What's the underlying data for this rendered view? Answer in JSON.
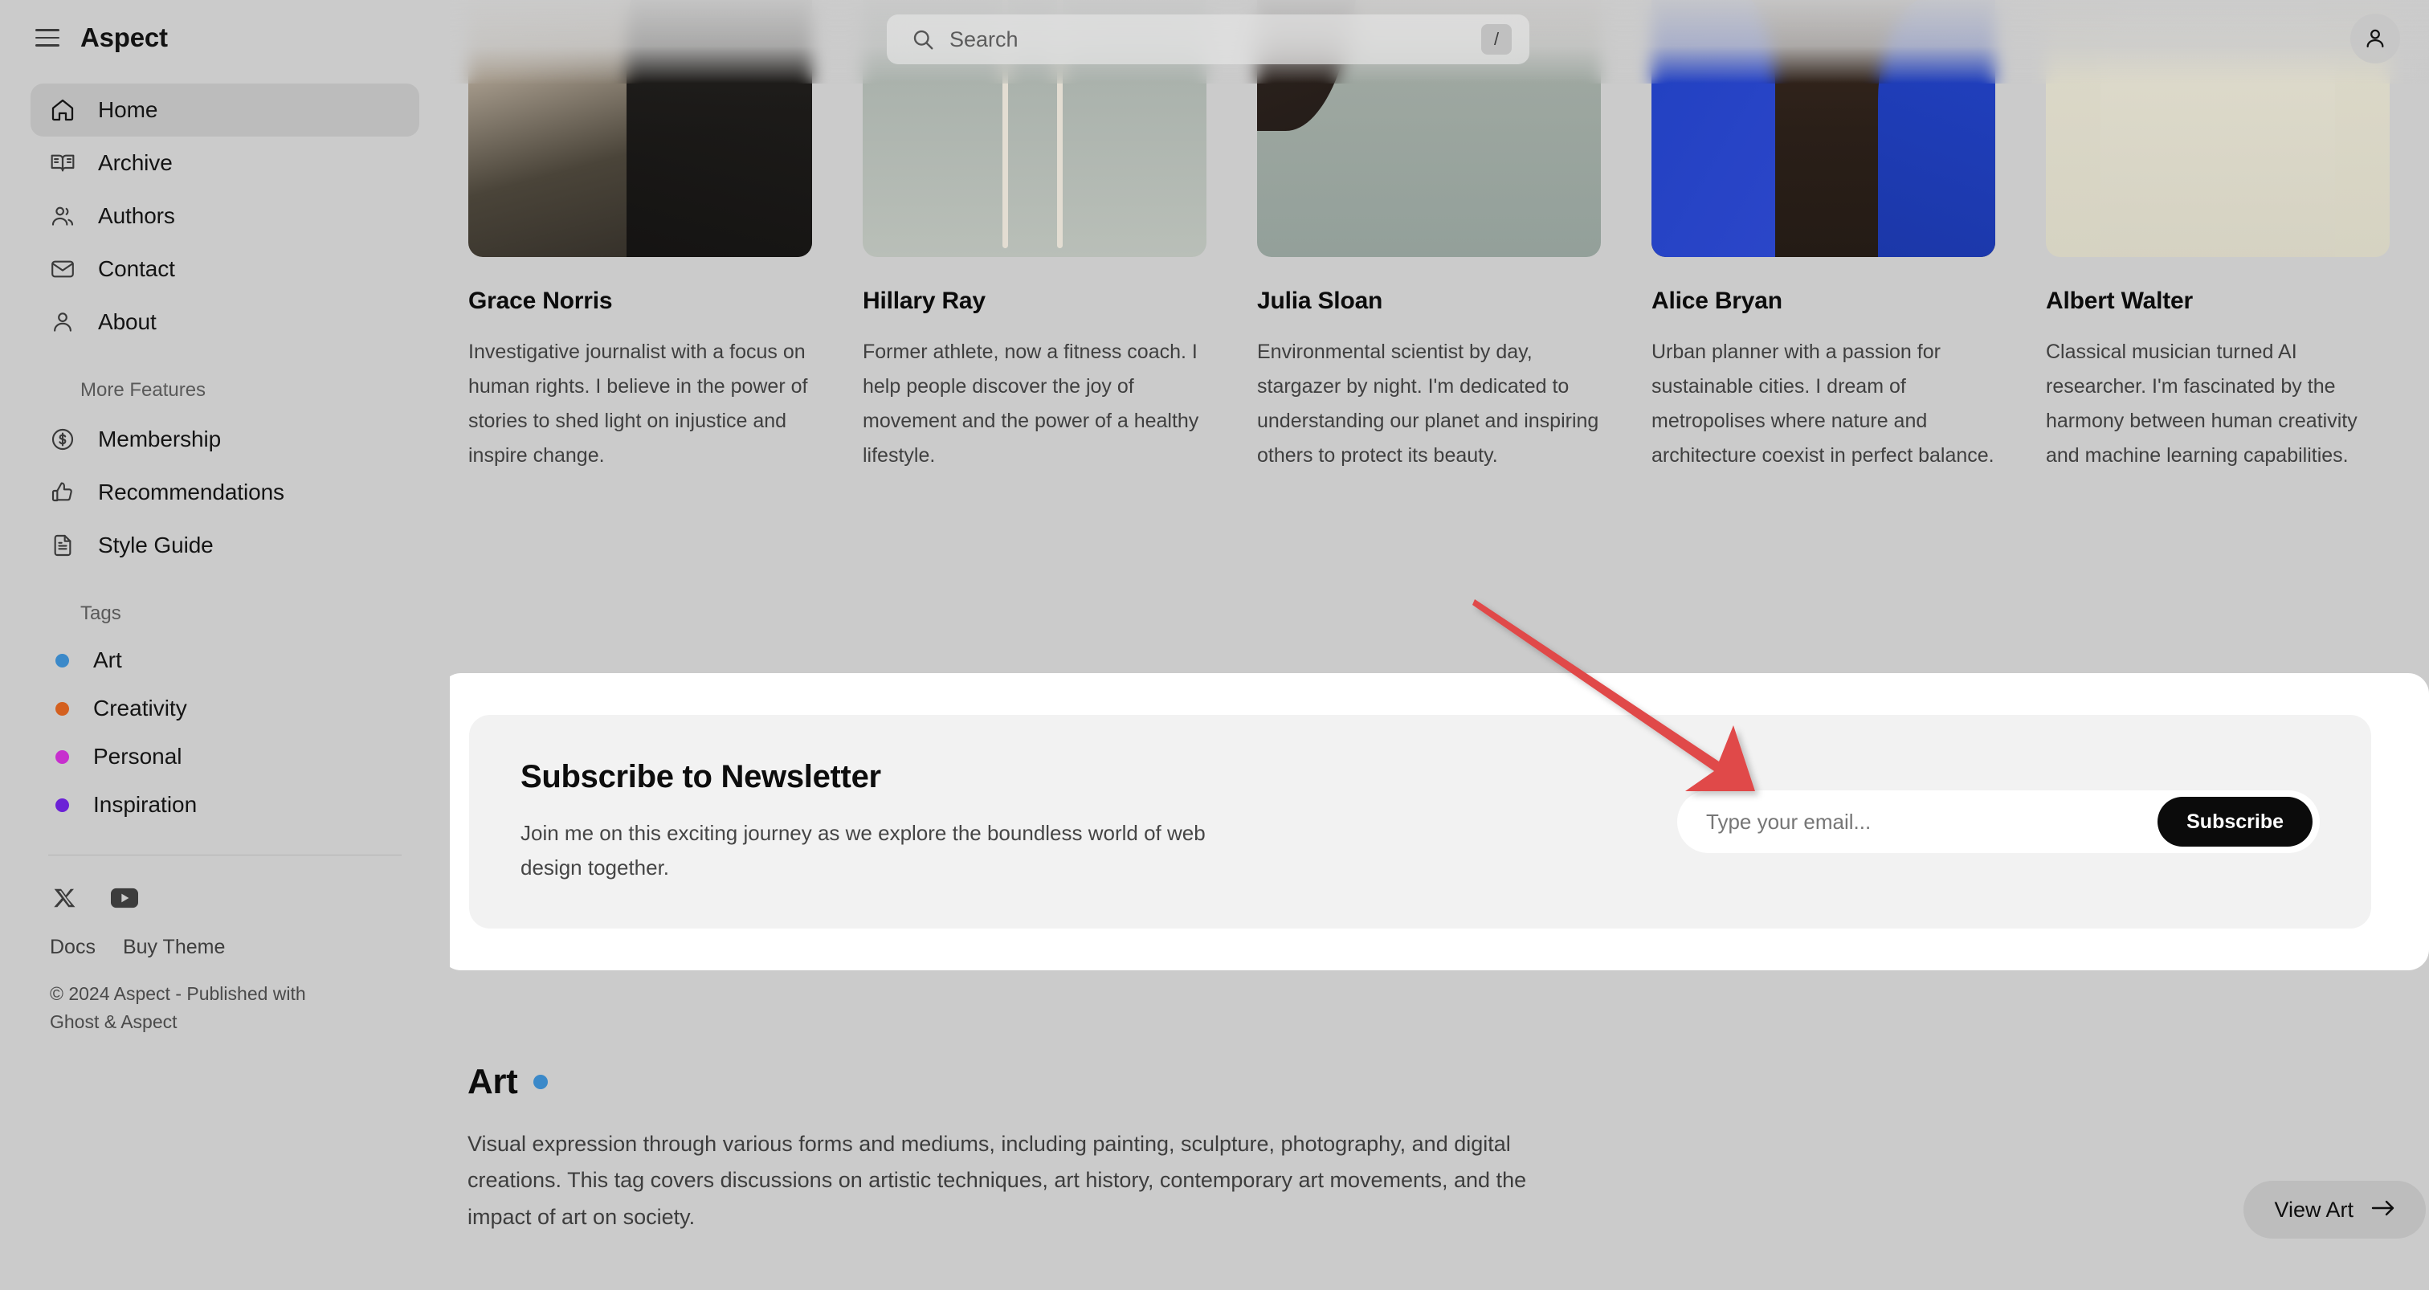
{
  "brand": {
    "name": "Aspect",
    "menu_icon": "hamburger-icon"
  },
  "search": {
    "placeholder": "Search",
    "shortcut": "/",
    "icon": "search-icon"
  },
  "header": {
    "account_icon": "user-avatar-icon"
  },
  "sidebar": {
    "nav": [
      {
        "label": "Home",
        "icon": "home-icon",
        "active": true
      },
      {
        "label": "Archive",
        "icon": "book-open-icon",
        "active": false
      },
      {
        "label": "Authors",
        "icon": "users-icon",
        "active": false
      },
      {
        "label": "Contact",
        "icon": "envelope-icon",
        "active": false
      },
      {
        "label": "About",
        "icon": "person-icon",
        "active": false
      }
    ],
    "more_features_label": "More Features",
    "features": [
      {
        "label": "Membership",
        "icon": "dollar-circle-icon"
      },
      {
        "label": "Recommendations",
        "icon": "thumbs-up-icon"
      },
      {
        "label": "Style Guide",
        "icon": "document-icon"
      }
    ],
    "tags_label": "Tags",
    "tags": [
      {
        "label": "Art",
        "color": "#3b89c9"
      },
      {
        "label": "Creativity",
        "color": "#d4601f"
      },
      {
        "label": "Personal",
        "color": "#c72fce"
      },
      {
        "label": "Inspiration",
        "color": "#6b21d6"
      }
    ],
    "socials": [
      {
        "name": "x-twitter-icon"
      },
      {
        "name": "youtube-icon"
      }
    ],
    "footer_links": [
      "Docs",
      "Buy Theme"
    ],
    "copyright": "© 2024 Aspect - Published with Ghost & Aspect"
  },
  "authors": [
    {
      "name": "Grace Norris",
      "bio": "Investigative journalist with a focus on human rights. I believe in the power of stories to shed light on injustice and inspire change.",
      "photo": "img1"
    },
    {
      "name": "Hillary Ray",
      "bio": "Former athlete, now a fitness coach. I help people discover the joy of movement and the power of a healthy lifestyle.",
      "photo": "img2"
    },
    {
      "name": "Julia Sloan",
      "bio": "Environmental scientist by day, stargazer by night. I'm dedicated to understanding our planet and inspiring others to protect its beauty.",
      "photo": "img3"
    },
    {
      "name": "Alice Bryan",
      "bio": "Urban planner with a passion for sustainable cities. I dream of metropolises where nature and architecture coexist in perfect balance.",
      "photo": "img4"
    },
    {
      "name": "Albert Walter",
      "bio": "Classical musician turned AI researcher. I'm fascinated by the harmony between human creativity and machine learning capabilities.",
      "photo": "img5"
    }
  ],
  "newsletter": {
    "title": "Subscribe to Newsletter",
    "subtitle": "Join me on this exciting journey as we explore the boundless world of web design together.",
    "email_placeholder": "Type your email...",
    "email_value": "",
    "button_label": "Subscribe"
  },
  "tag_section": {
    "title": "Art",
    "dot_color": "#3b89c9",
    "description": "Visual expression through various forms and mediums, including painting, sculpture, photography, and digital creations. This tag covers discussions on artistic techniques, art history, contemporary art movements, and the impact of art on society.",
    "view_button": "View Art",
    "view_button_icon": "arrow-right-icon"
  },
  "annotation": {
    "arrow_color": "#e04a4a",
    "type": "pointer-arrow"
  },
  "colors": {
    "page_bg": "#cbcbcb",
    "card_white": "#ffffff",
    "card_inner": "#f2f2f2",
    "accent_dark": "#0b0b0b"
  }
}
